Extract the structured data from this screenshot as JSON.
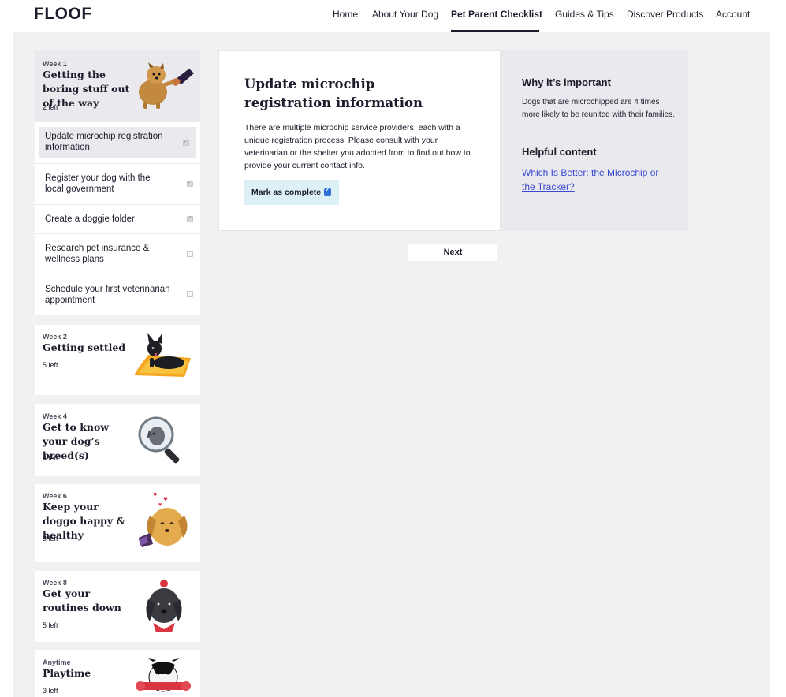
{
  "brand": {
    "logo": "FLOOF"
  },
  "nav": {
    "items": [
      "Home",
      "About Your Dog",
      "Pet Parent Checklist",
      "Guides & Tips",
      "Discover Products",
      "Account"
    ],
    "active": "Pet Parent Checklist"
  },
  "weeks": [
    {
      "label": "Week 1",
      "title": "Getting the boring stuff out of the way",
      "left": "2 left",
      "art": "dog-shaking-hand-icon"
    },
    {
      "label": "Week 2",
      "title": "Getting settled",
      "left": "5 left",
      "art": "dog-on-bed-icon"
    },
    {
      "label": "Week 4",
      "title": "Get to know your dog’s breed(s)",
      "left": "4 left",
      "art": "magnifying-glass-dog-icon"
    },
    {
      "label": "Week 6",
      "title": "Keep your doggo happy & healthy",
      "left": "3 left",
      "art": "happy-dog-hearts-icon"
    },
    {
      "label": "Week 8",
      "title": "Get your routines down",
      "left": "5 left",
      "art": "groomed-dog-icon"
    },
    {
      "label": "Anytime",
      "title": "Playtime",
      "left": "3 left",
      "art": "dog-with-toy-icon"
    }
  ],
  "tasks": [
    {
      "label": "Update microchip registration information",
      "done": true,
      "selected": true
    },
    {
      "label": "Register your dog with the local government",
      "done": true,
      "selected": false
    },
    {
      "label": "Create a doggie folder",
      "done": true,
      "selected": false
    },
    {
      "label": "Research pet insurance & wellness plans",
      "done": false,
      "selected": false
    },
    {
      "label": "Schedule your first veterinarian appointment",
      "done": false,
      "selected": false
    }
  ],
  "detail": {
    "title": "Update microchip registration information",
    "description": "There are multiple microchip service providers, each with a unique registration process. Please consult with your veterinarian or the shelter you adopted from to find out how to provide your current contact info.",
    "complete_label": "Mark as complete",
    "complete_checked": true
  },
  "aside": {
    "why_heading": "Why it’s important",
    "why_text": "Dogs that are microchipped are 4 times more likely to be reunited with their families.",
    "helpful_heading": "Helpful content",
    "link_text": "Which Is Better: the Microchip or the Tracker?"
  },
  "next_label": "Next",
  "colors": {
    "text": "#1c1c2b",
    "panel": "#e9e9ee",
    "background": "#f1f1f1",
    "link": "#3a4bd0",
    "checkbox": "#2f6fd8",
    "button_bg": "#dcf0f6"
  }
}
